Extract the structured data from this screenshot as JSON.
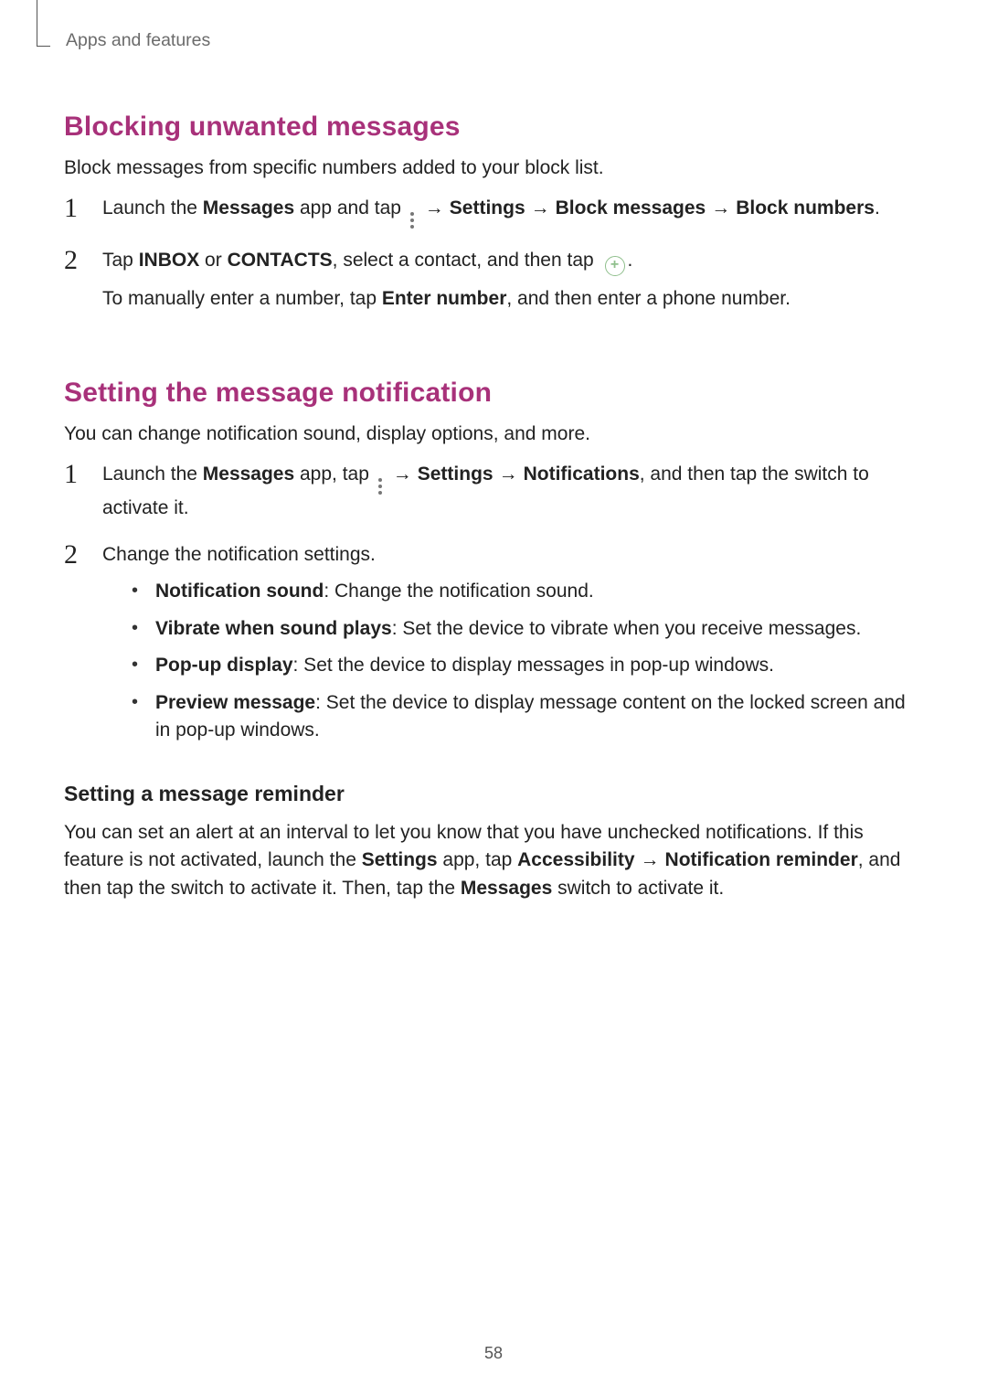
{
  "breadcrumb": "Apps and features",
  "page_number": "58",
  "arrow": "→",
  "sections": {
    "block": {
      "title": "Blocking unwanted messages",
      "lead": "Block messages from specific numbers added to your block list.",
      "step1": {
        "num": "1",
        "t1": "Launch the ",
        "b1": "Messages",
        "t2": " app and tap ",
        "nav1": "Settings",
        "nav2": "Block messages",
        "nav3": "Block numbers",
        "t3": "."
      },
      "step2": {
        "num": "2",
        "t1": "Tap ",
        "b1": "INBOX",
        "t2": " or ",
        "b2": "CONTACTS",
        "t3": ", select a contact, and then tap ",
        "t4": ".",
        "line2a": "To manually enter a number, tap ",
        "line2b": "Enter number",
        "line2c": ", and then enter a phone number."
      }
    },
    "notif": {
      "title": "Setting the message notification",
      "lead": "You can change notification sound, display options, and more.",
      "step1": {
        "num": "1",
        "t1": "Launch the ",
        "b1": "Messages",
        "t2": " app, tap ",
        "nav1": "Settings",
        "nav2": "Notifications",
        "t3": ", and then tap the switch to activate it."
      },
      "step2": {
        "num": "2",
        "lead": "Change the notification settings.",
        "b1": {
          "label": "Notification sound",
          "text": ": Change the notification sound."
        },
        "b2": {
          "label": "Vibrate when sound plays",
          "text": ": Set the device to vibrate when you receive messages."
        },
        "b3": {
          "label": "Pop-up display",
          "text": ": Set the device to display messages in pop-up windows."
        },
        "b4": {
          "label": "Preview message",
          "text": ": Set the device to display message content on the locked screen and in pop-up windows."
        }
      },
      "reminder": {
        "title": "Setting a message reminder",
        "p1a": "You can set an alert at an interval to let you know that you have unchecked notifications. If this feature is not activated, launch the ",
        "b1": "Settings",
        "p1b": " app, tap ",
        "b2": "Accessibility",
        "b3": "Notification reminder",
        "p1c": ", and then tap the switch to activate it. Then, tap the ",
        "b4": "Messages",
        "p1d": " switch to activate it."
      }
    }
  }
}
